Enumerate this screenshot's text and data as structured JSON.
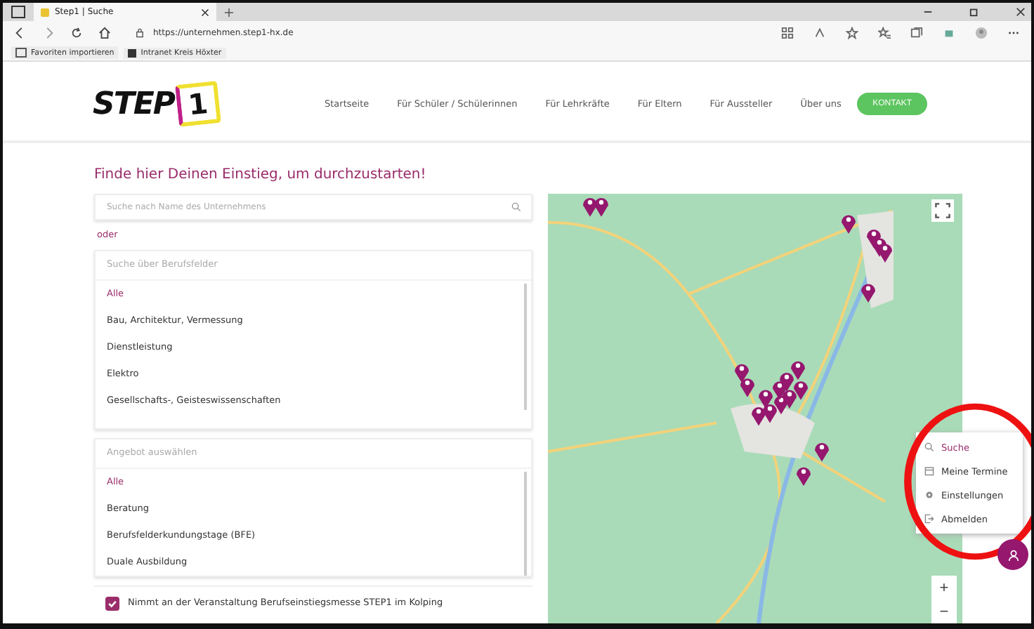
{
  "browser": {
    "tab_title": "Step1 | Suche",
    "url": "https://unternehmen.step1-hx.de",
    "bookmarks": [
      "Favoriten importieren",
      "Intranet Kreis Höxter"
    ]
  },
  "header": {
    "logo": "STEP",
    "logo_number": "1",
    "nav": [
      {
        "label": "Startseite"
      },
      {
        "label": "Für Schüler / Schülerinnen"
      },
      {
        "label": "Für Lehrkräfte"
      },
      {
        "label": "Für Eltern"
      },
      {
        "label": "Für Aussteller"
      },
      {
        "label": "Über uns"
      }
    ],
    "cta": "KONTAKT"
  },
  "heading": "Finde hier Deinen Einstieg, um durchzustarten!",
  "search": {
    "placeholder": "Suche nach Name des Unternehmens"
  },
  "or_label": "oder",
  "lists": [
    {
      "placeholder": "Suche über Berufsfelder",
      "items": [
        {
          "label": "Alle",
          "selected": true
        },
        {
          "label": "Bau, Architektur, Vermessung",
          "selected": false
        },
        {
          "label": "Dienstleistung",
          "selected": false
        },
        {
          "label": "Elektro",
          "selected": false
        },
        {
          "label": "Gesellschafts-, Geisteswissenschaften",
          "selected": false
        }
      ]
    },
    {
      "placeholder": "Angebot auswählen",
      "items": [
        {
          "label": "Alle",
          "selected": true
        },
        {
          "label": "Beratung",
          "selected": false
        },
        {
          "label": "Berufsfelderkundungstage (BFE)",
          "selected": false
        },
        {
          "label": "Duale Ausbildung",
          "selected": false
        }
      ]
    }
  ],
  "event_filter": {
    "label": "Nimmt an der Veranstaltung Berufseinstiegsmesse STEP1 im Kolping",
    "checked": true
  },
  "map": {
    "zoom_in": "+",
    "zoom_out": "−"
  },
  "user_menu": [
    {
      "label": "Suche",
      "kind": "search",
      "selected": true
    },
    {
      "label": "Meine Termine",
      "kind": "calendar",
      "selected": false
    },
    {
      "label": "Einstellungen",
      "kind": "settings",
      "selected": false
    },
    {
      "label": "Abmelden",
      "kind": "logout",
      "selected": false
    }
  ]
}
